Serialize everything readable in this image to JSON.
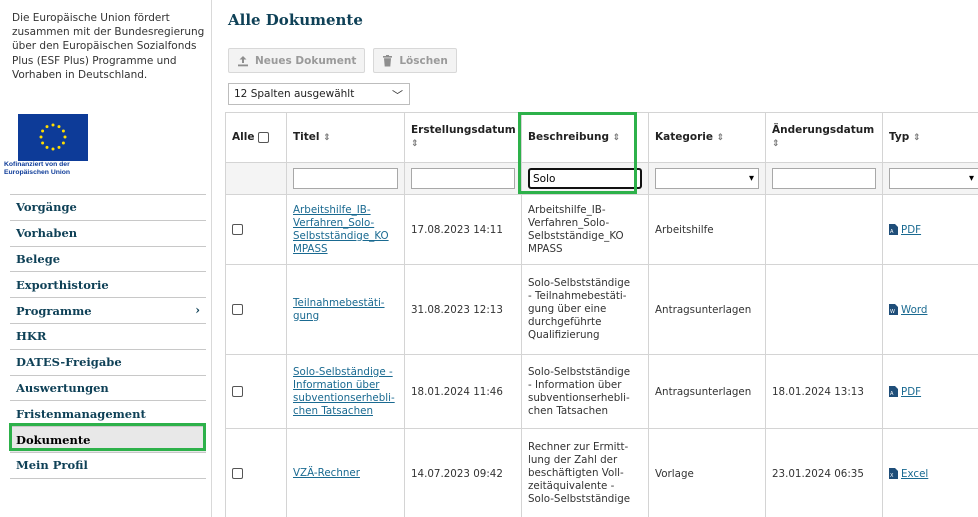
{
  "sidebar": {
    "esf_text": "Die Europäische Union fördert zusammen mit der Bundesregierung über den Europäischen Sozialfonds Plus (ESF Plus) Programme und Vorhaben in Deutschland.",
    "eu_caption_line1": "Kofinanziert von der",
    "eu_caption_line2": "Europäischen Union",
    "nav": [
      {
        "label": "Vorgänge"
      },
      {
        "label": "Vorhaben"
      },
      {
        "label": "Belege"
      },
      {
        "label": "Exporthistorie"
      },
      {
        "label": "Programme",
        "chevron": "›"
      },
      {
        "label": "HKR"
      },
      {
        "label": "DATES-Freigabe"
      },
      {
        "label": "Auswertungen"
      },
      {
        "label": "Fristenmanagement"
      },
      {
        "label": "Dokumente",
        "active": true
      },
      {
        "label": "Mein Profil"
      }
    ]
  },
  "main": {
    "title": "Alle Dokumente",
    "toolbar": {
      "new_label": "Neues Dokument",
      "delete_label": "Löschen"
    },
    "column_select": "12 Spalten ausgewählt",
    "table": {
      "headers": {
        "alle": "Alle",
        "titel": "Titel",
        "erstellungsdatum": "Erstellungsdatum",
        "beschreibung": "Beschreibung",
        "kategorie": "Kategorie",
        "aenderungsdatum": "Änderungsdatum",
        "typ": "Typ"
      },
      "sort_icon": "⇕",
      "filter": {
        "beschreibung": "Solo"
      },
      "rows": [
        {
          "titel": "Arbeitshilfe_IB-Verfahren_Solo-Selbstständige_KOMPASS",
          "titel_lines": [
            "Arbeitshilfe_IB-",
            "Verfahren_Solo-",
            "Selbstständige_KO",
            "MPASS"
          ],
          "erstellungsdatum": "17.08.2023 14:11",
          "beschreibung_lines": [
            "Arbeitshilfe_IB-",
            "Verfahren_Solo-",
            "Selbstständige_KO",
            "MPASS"
          ],
          "kategorie": "Arbeitshilfe",
          "aenderungsdatum": "",
          "typ": "PDF",
          "typ_icon": "pdf-icon"
        },
        {
          "titel_lines": [
            "Teilnahmebestäti-",
            "gung"
          ],
          "erstellungsdatum": "31.08.2023 12:13",
          "beschreibung_lines": [
            "Solo-Selbstständige",
            "- Teilnahmebestäti-",
            "gung über eine",
            "durchgeführte",
            "Qualifizierung"
          ],
          "kategorie": "Antragsunterlagen",
          "aenderungsdatum": "",
          "typ": "Word",
          "typ_icon": "word-icon"
        },
        {
          "titel_lines": [
            "Solo-Selbständige -",
            "Information über",
            "subventionserhebli-",
            "chen Tatsachen"
          ],
          "erstellungsdatum": "18.01.2024 11:46",
          "beschreibung_lines": [
            "Solo-Selbstständige",
            "- Information über",
            "subventionserhebli-",
            "chen Tatsachen"
          ],
          "kategorie": "Antragsunterlagen",
          "aenderungsdatum": "18.01.2024 13:13",
          "typ": "PDF",
          "typ_icon": "pdf-icon"
        },
        {
          "titel_lines": [
            "VZÄ-Rechner"
          ],
          "erstellungsdatum": "14.07.2023 09:42",
          "beschreibung_lines": [
            "Rechner zur Ermitt-",
            "lung der Zahl der",
            "beschäftigten Voll-",
            "zeitäquivalente -",
            "Solo-Selbstständige"
          ],
          "kategorie": "Vorlage",
          "aenderungsdatum": "23.01.2024 06:35",
          "typ": "Excel",
          "typ_icon": "excel-icon"
        }
      ]
    }
  },
  "colors": {
    "primary": "#0f4157",
    "link": "#1a6a91",
    "highlight": "#2db14a",
    "eu_blue": "#0d3b98"
  }
}
